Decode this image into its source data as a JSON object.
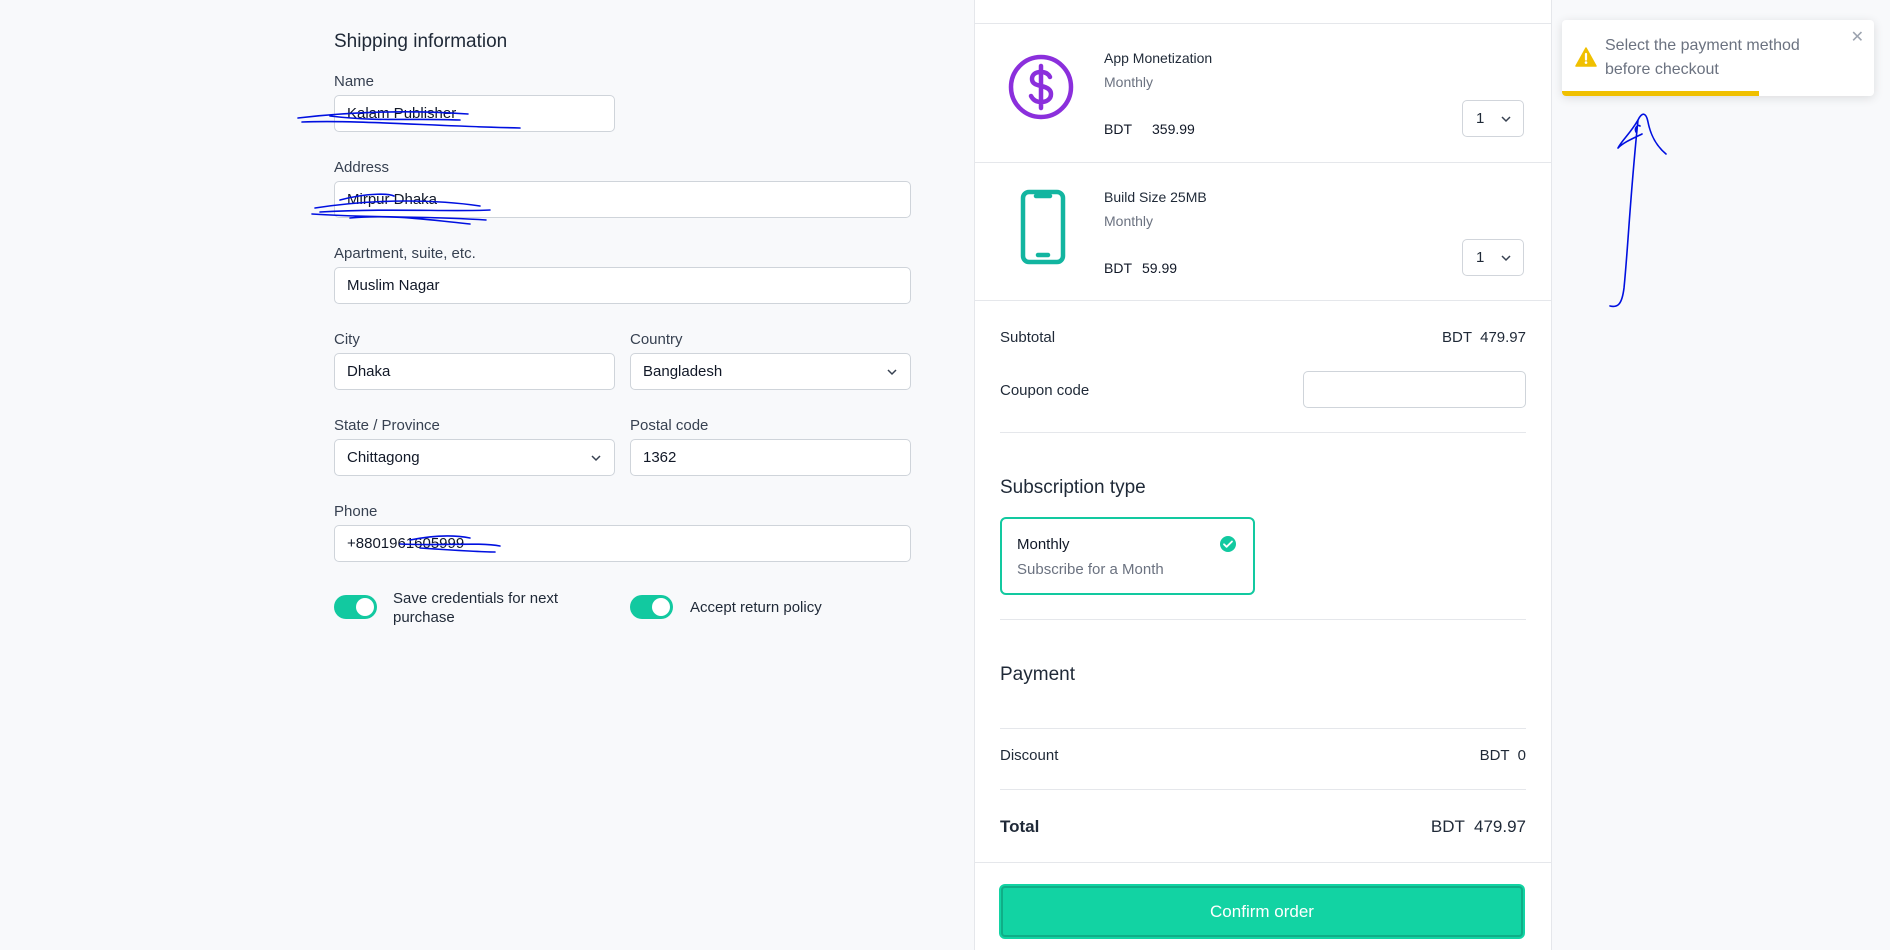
{
  "shipping": {
    "title": "Shipping information",
    "name_label": "Name",
    "name_value": "Kalam Publisher",
    "address_label": "Address",
    "address_value": "Mirpur Dhaka",
    "apartment_label": "Apartment, suite, etc.",
    "apartment_value": "Muslim Nagar",
    "city_label": "City",
    "city_value": "Dhaka",
    "country_label": "Country",
    "country_value": "Bangladesh",
    "state_label": "State / Province",
    "state_value": "Chittagong",
    "postal_label": "Postal code",
    "postal_value": "1362",
    "phone_label": "Phone",
    "phone_value": "+8801961605999",
    "save_credentials_label": "Save credentials for next purchase",
    "save_credentials_on": true,
    "return_policy_label": "Accept return policy",
    "return_policy_on": true
  },
  "cart": {
    "items": [
      {
        "name": "App Monetization",
        "period": "Monthly",
        "currency": "BDT",
        "price": "359.99",
        "qty": "1",
        "icon": "dollar-circle-icon"
      },
      {
        "name": "Build Size 25MB",
        "period": "Monthly",
        "currency": "BDT",
        "price": "59.99",
        "qty": "1",
        "icon": "phone-icon"
      }
    ],
    "subtotal_label": "Subtotal",
    "subtotal_value": "BDT  479.97",
    "coupon_label": "Coupon code",
    "coupon_value": "",
    "subscription_title": "Subscription type",
    "subscription": {
      "name": "Monthly",
      "desc": "Subscribe for a Month"
    },
    "payment_title": "Payment",
    "discount_label": "Discount",
    "discount_value": "BDT  0",
    "total_label": "Total",
    "total_value": "BDT  479.97",
    "confirm_label": "Confirm order"
  },
  "toast": {
    "message": "Select the payment method before checkout",
    "progress": 0.63
  },
  "colors": {
    "accent": "#12d3a3",
    "purple": "#8b2fdc",
    "teal": "#12b5a0",
    "warning": "#f0c000",
    "annotation": "#0010e0"
  }
}
